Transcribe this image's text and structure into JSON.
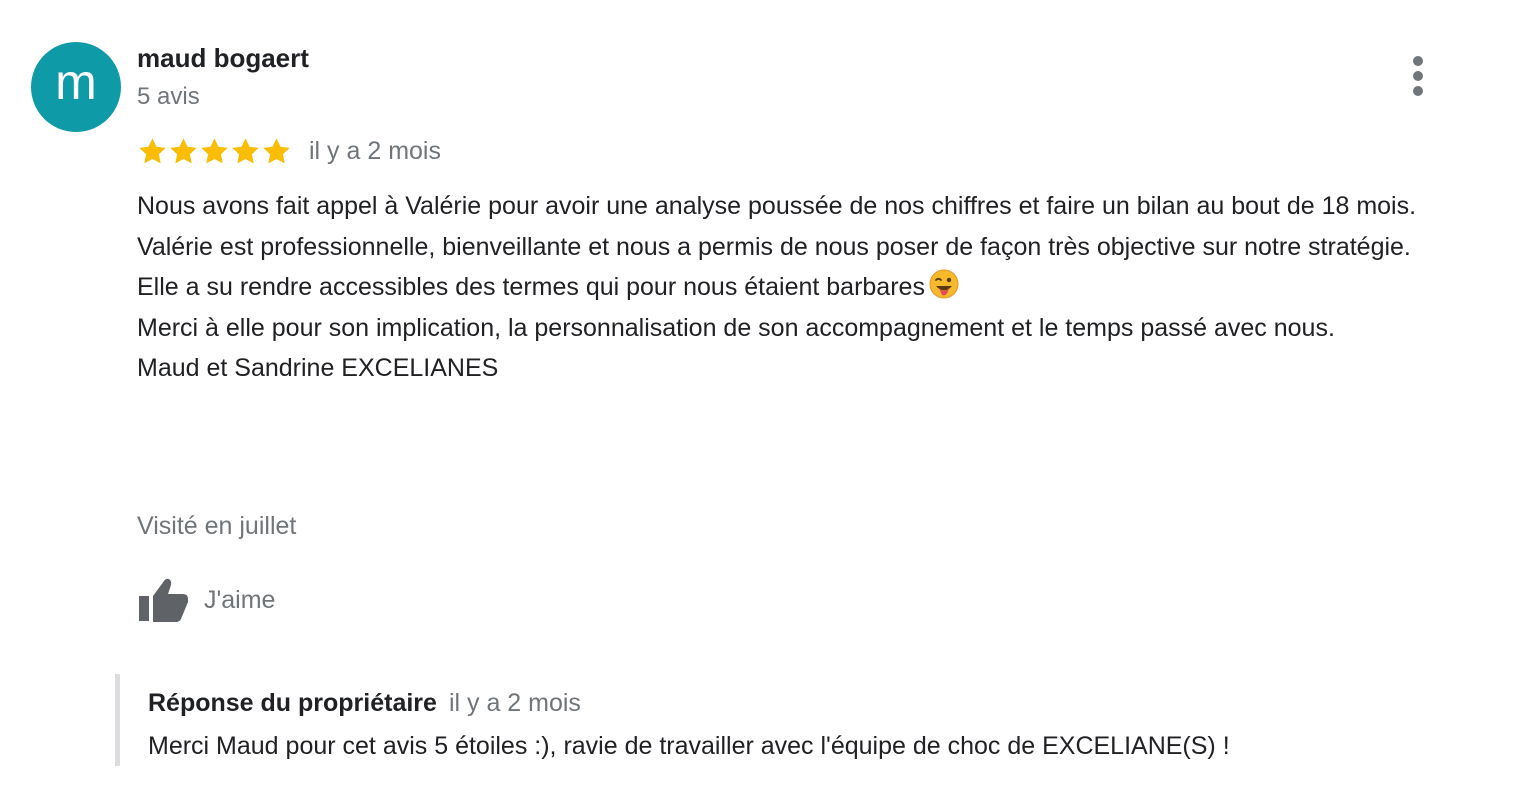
{
  "review": {
    "author": {
      "avatar_letter": "m",
      "avatar_color": "#0f9aa8",
      "name": "maud bogaert",
      "review_count": "5 avis"
    },
    "more_icon": "more-vert-icon",
    "rating": 5,
    "rating_max": 5,
    "star_color": "#fbbc04",
    "time": "il y a 2 mois",
    "text_lines": [
      "Nous avons fait appel à Valérie pour avoir une analyse poussée de nos chiffres et faire un bilan au bout de 18 mois.",
      "Valérie est professionnelle, bienveillante et nous a permis de nous poser de façon très objective sur notre stratégie.",
      "Elle a su rendre accessibles des termes qui pour nous étaient barbares",
      "Merci à elle pour son implication, la personnalisation de son accompagnement  et le temps passé avec nous.",
      "Maud et Sandrine EXCELIANES"
    ],
    "emoji": "winking-face-with-tongue-emoji",
    "visited": "Visité en juillet",
    "like": {
      "icon": "thumb-up-icon",
      "label": "J'aime"
    }
  },
  "owner_reply": {
    "label": "Réponse du propriétaire",
    "time": "il y a 2 mois",
    "text": "Merci Maud pour cet avis 5 étoiles :), ravie de travailler avec l'équipe de choc de EXCELIANE(S) !"
  }
}
